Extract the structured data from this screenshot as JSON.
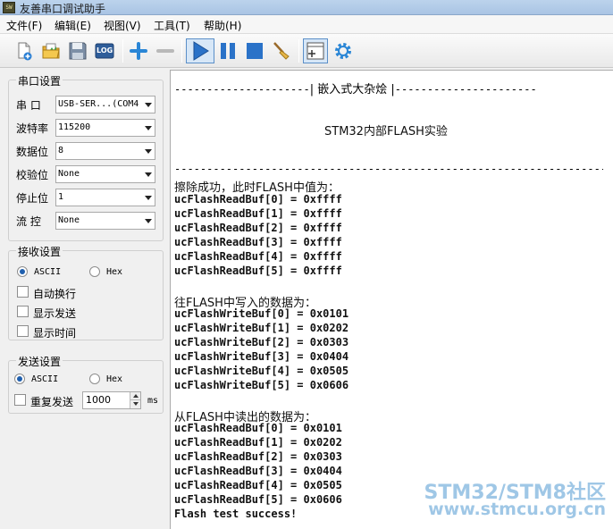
{
  "window": {
    "title": "友善串口调试助手",
    "icon_text": "SW"
  },
  "menu": [
    "文件(F)",
    "编辑(E)",
    "视图(V)",
    "工具(T)",
    "帮助(H)"
  ],
  "toolbar": {
    "log_label": "LOG",
    "icons": [
      "new-file-icon",
      "open-folder-icon",
      "save-icon",
      "log-icon",
      "add-icon",
      "remove-icon",
      "play-icon",
      "pause-icon",
      "stop-icon",
      "clear-broom-icon",
      "add-panel-icon",
      "gear-icon"
    ]
  },
  "serial": {
    "title": "串口设置",
    "fields": [
      {
        "label": "串  口",
        "value": "USB-SER...(COM4"
      },
      {
        "label": "波特率",
        "value": "115200"
      },
      {
        "label": "数据位",
        "value": "8"
      },
      {
        "label": "校验位",
        "value": "None"
      },
      {
        "label": "停止位",
        "value": "1"
      },
      {
        "label": "流  控",
        "value": "None"
      }
    ]
  },
  "receive": {
    "title": "接收设置",
    "mode_ascii": "ASCII",
    "mode_hex": "Hex",
    "selected": "ASCII",
    "options": [
      {
        "label": "自动换行",
        "checked": false
      },
      {
        "label": "显示发送",
        "checked": false
      },
      {
        "label": "显示时间",
        "checked": false
      }
    ]
  },
  "send": {
    "title": "发送设置",
    "mode_ascii": "ASCII",
    "mode_hex": "Hex",
    "selected": "ASCII",
    "repeat_label": "重复发送",
    "repeat_checked": false,
    "interval": "1000",
    "unit": "ms"
  },
  "output": {
    "header_left": "---------------------",
    "header_title": "| 嵌入式大杂烩 |",
    "header_right": "----------------------",
    "subtitle": "STM32内部FLASH实验",
    "separator": "--------------------------------------------------------------------------",
    "erase_title": "擦除成功，此时FLASH中值为：",
    "erase_lines": [
      "ucFlashReadBuf[0] = 0xffff",
      "ucFlashReadBuf[1] = 0xffff",
      "ucFlashReadBuf[2] = 0xffff",
      "ucFlashReadBuf[3] = 0xffff",
      "ucFlashReadBuf[4] = 0xffff",
      "ucFlashReadBuf[5] = 0xffff"
    ],
    "write_title": "往FLASH中写入的数据为：",
    "write_lines": [
      "ucFlashWriteBuf[0] = 0x0101",
      "ucFlashWriteBuf[1] = 0x0202",
      "ucFlashWriteBuf[2] = 0x0303",
      "ucFlashWriteBuf[3] = 0x0404",
      "ucFlashWriteBuf[4] = 0x0505",
      "ucFlashWriteBuf[5] = 0x0606"
    ],
    "read_title": "从FLASH中读出的数据为：",
    "read_lines": [
      "ucFlashReadBuf[0] = 0x0101",
      "ucFlashReadBuf[1] = 0x0202",
      "ucFlashReadBuf[2] = 0x0303",
      "ucFlashReadBuf[3] = 0x0404",
      "ucFlashReadBuf[4] = 0x0505",
      "ucFlashReadBuf[5] = 0x0606"
    ],
    "success": "Flash test success!"
  },
  "watermark": {
    "line1": "STM32/STM8社区",
    "line2": "www.stmcu.org.cn"
  }
}
